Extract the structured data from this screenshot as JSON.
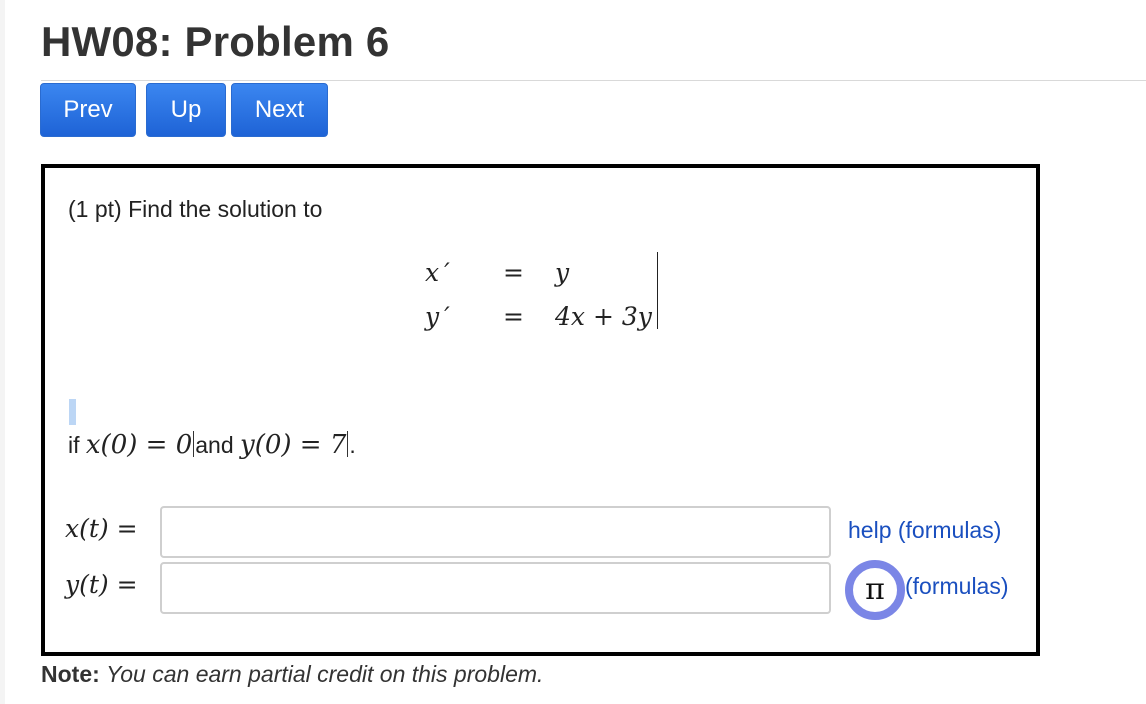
{
  "page": {
    "title": "HW08: Problem 6"
  },
  "nav": {
    "prev_label": "Prev",
    "up_label": "Up",
    "next_label": "Next",
    "color": "#2f77e6"
  },
  "problem": {
    "intro": "(1 pt) Find the solution to",
    "system": {
      "row1_lhs": "x ′",
      "row1_eq": "=",
      "row1_rhs": "y",
      "row2_lhs": "y ′",
      "row2_eq": "=",
      "row2_rhs": "4x + 3y"
    },
    "condition": {
      "prefix": "if ",
      "x0": "x(0) = 0",
      "middle": "and ",
      "y0": "y(0) = 7",
      "suffix": "."
    },
    "answers": [
      {
        "label": "x(t) =",
        "value": "",
        "link_label": "help (formulas)"
      },
      {
        "label": "y(t) =",
        "value": "",
        "link_label": "(formulas)",
        "icon": "pi-icon"
      }
    ],
    "pi_symbol": "π"
  },
  "note": {
    "bold": "Note:",
    "text": "You can earn partial credit on this problem."
  }
}
